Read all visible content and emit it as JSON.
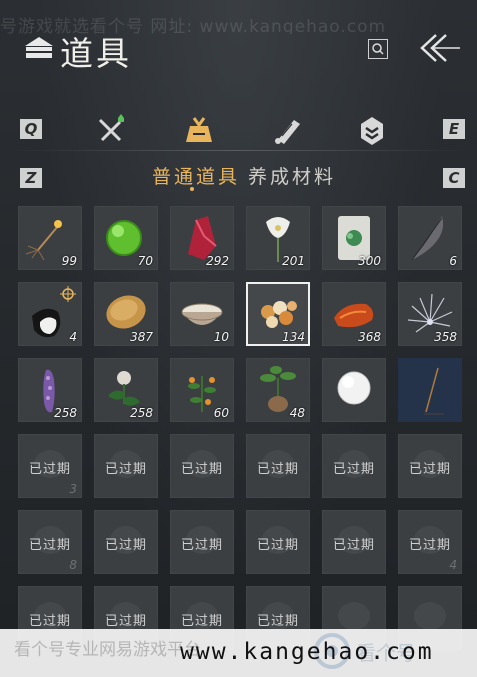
{
  "watermark_top": "号游戏就选看个号  网址: www.kangehao.com",
  "header": {
    "title": "道具",
    "title_icon": "inventory-icon",
    "search_icon": "search-icon",
    "back_icon": "back-arrow-icon"
  },
  "category_tabs": {
    "left_key": "Q",
    "right_key": "E",
    "items": [
      {
        "icon": "weapon-crossed-icon",
        "active": false
      },
      {
        "icon": "pouch-icon",
        "active": true
      },
      {
        "icon": "scroll-icon",
        "active": false
      },
      {
        "icon": "badge-icon",
        "active": false
      }
    ],
    "accent": "#e9b55c"
  },
  "sub_tabs": {
    "left_key": "Z",
    "right_key": "C",
    "items": [
      {
        "label": "普通道具",
        "active": true
      },
      {
        "label": "养成材料",
        "active": false
      }
    ]
  },
  "items": [
    {
      "art": "firework",
      "count": "99"
    },
    {
      "art": "green-orb",
      "count": "70"
    },
    {
      "art": "red-crystal",
      "count": "292"
    },
    {
      "art": "white-flower",
      "count": "201"
    },
    {
      "art": "jade-box",
      "count": "300"
    },
    {
      "art": "feather",
      "count": "6"
    },
    {
      "art": "tassel",
      "count": "4"
    },
    {
      "art": "bread-loaf",
      "count": "387"
    },
    {
      "art": "rice-bowl",
      "count": "10"
    },
    {
      "art": "dumplings",
      "count": "134"
    },
    {
      "art": "roast-meat",
      "count": "368"
    },
    {
      "art": "spark-plant",
      "count": "358"
    },
    {
      "art": "lavender",
      "count": "258"
    },
    {
      "art": "white-blossom",
      "count": "258"
    },
    {
      "art": "orange-herb",
      "count": "60"
    },
    {
      "art": "root-herb",
      "count": "48"
    },
    {
      "art": "snowball",
      "count": ""
    },
    {
      "art": "incense-scene",
      "count": ""
    },
    {
      "expired": "已过期",
      "count": "3"
    },
    {
      "expired": "已过期",
      "count": ""
    },
    {
      "expired": "已过期",
      "count": ""
    },
    {
      "expired": "已过期",
      "count": ""
    },
    {
      "expired": "已过期",
      "count": ""
    },
    {
      "expired": "已过期",
      "count": ""
    },
    {
      "expired": "已过期",
      "count": "8"
    },
    {
      "expired": "已过期",
      "count": ""
    },
    {
      "expired": "已过期",
      "count": ""
    },
    {
      "expired": "已过期",
      "count": ""
    },
    {
      "expired": "已过期",
      "count": ""
    },
    {
      "expired": "已过期",
      "count": "4"
    },
    {
      "expired": "已过期",
      "count": ""
    },
    {
      "expired": "已过期",
      "count": ""
    },
    {
      "expired": "已过期",
      "count": ""
    },
    {
      "expired": "已过期",
      "count": ""
    },
    {
      "expired": "",
      "count": ""
    },
    {
      "expired": "",
      "count": ""
    }
  ],
  "selected_index": 9,
  "footer": {
    "faded_text": "看个号专业网易游戏平台",
    "url": "www.kangehao.com",
    "brand": "看个号",
    "logo_icon": "kangehao-logo-icon"
  }
}
